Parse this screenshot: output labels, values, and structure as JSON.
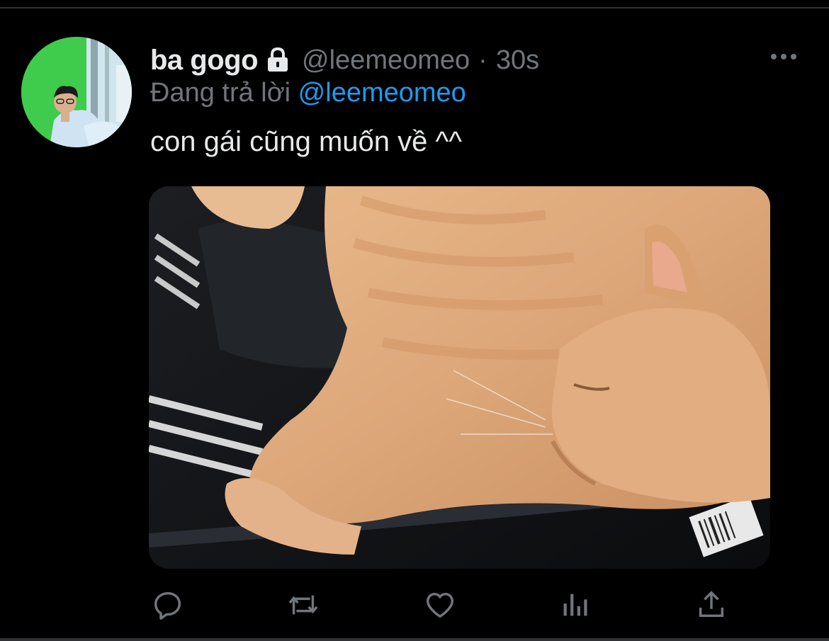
{
  "tweet": {
    "author": {
      "display_name": "ba gogo",
      "handle": "@leemeomeo",
      "protected_icon": "lock-icon",
      "avatar": "avatar"
    },
    "separator": "·",
    "timestamp": "30s",
    "reply_prefix": "Đang trả lời",
    "reply_to": "@leemeomeo",
    "text": "con gái cũng muốn về ^^",
    "media": "photo"
  },
  "actions": [
    {
      "name": "reply",
      "icon": "reply-icon"
    },
    {
      "name": "retweet",
      "icon": "retweet-icon"
    },
    {
      "name": "like",
      "icon": "heart-icon"
    },
    {
      "name": "analytics",
      "icon": "analytics-icon"
    },
    {
      "name": "share",
      "icon": "share-icon"
    }
  ],
  "menu_icon": "more-icon",
  "colors": {
    "background": "#000000",
    "text_primary": "#e7e9ea",
    "text_secondary": "#71767b",
    "link": "#1d9bf0",
    "divider": "#2f3336"
  }
}
